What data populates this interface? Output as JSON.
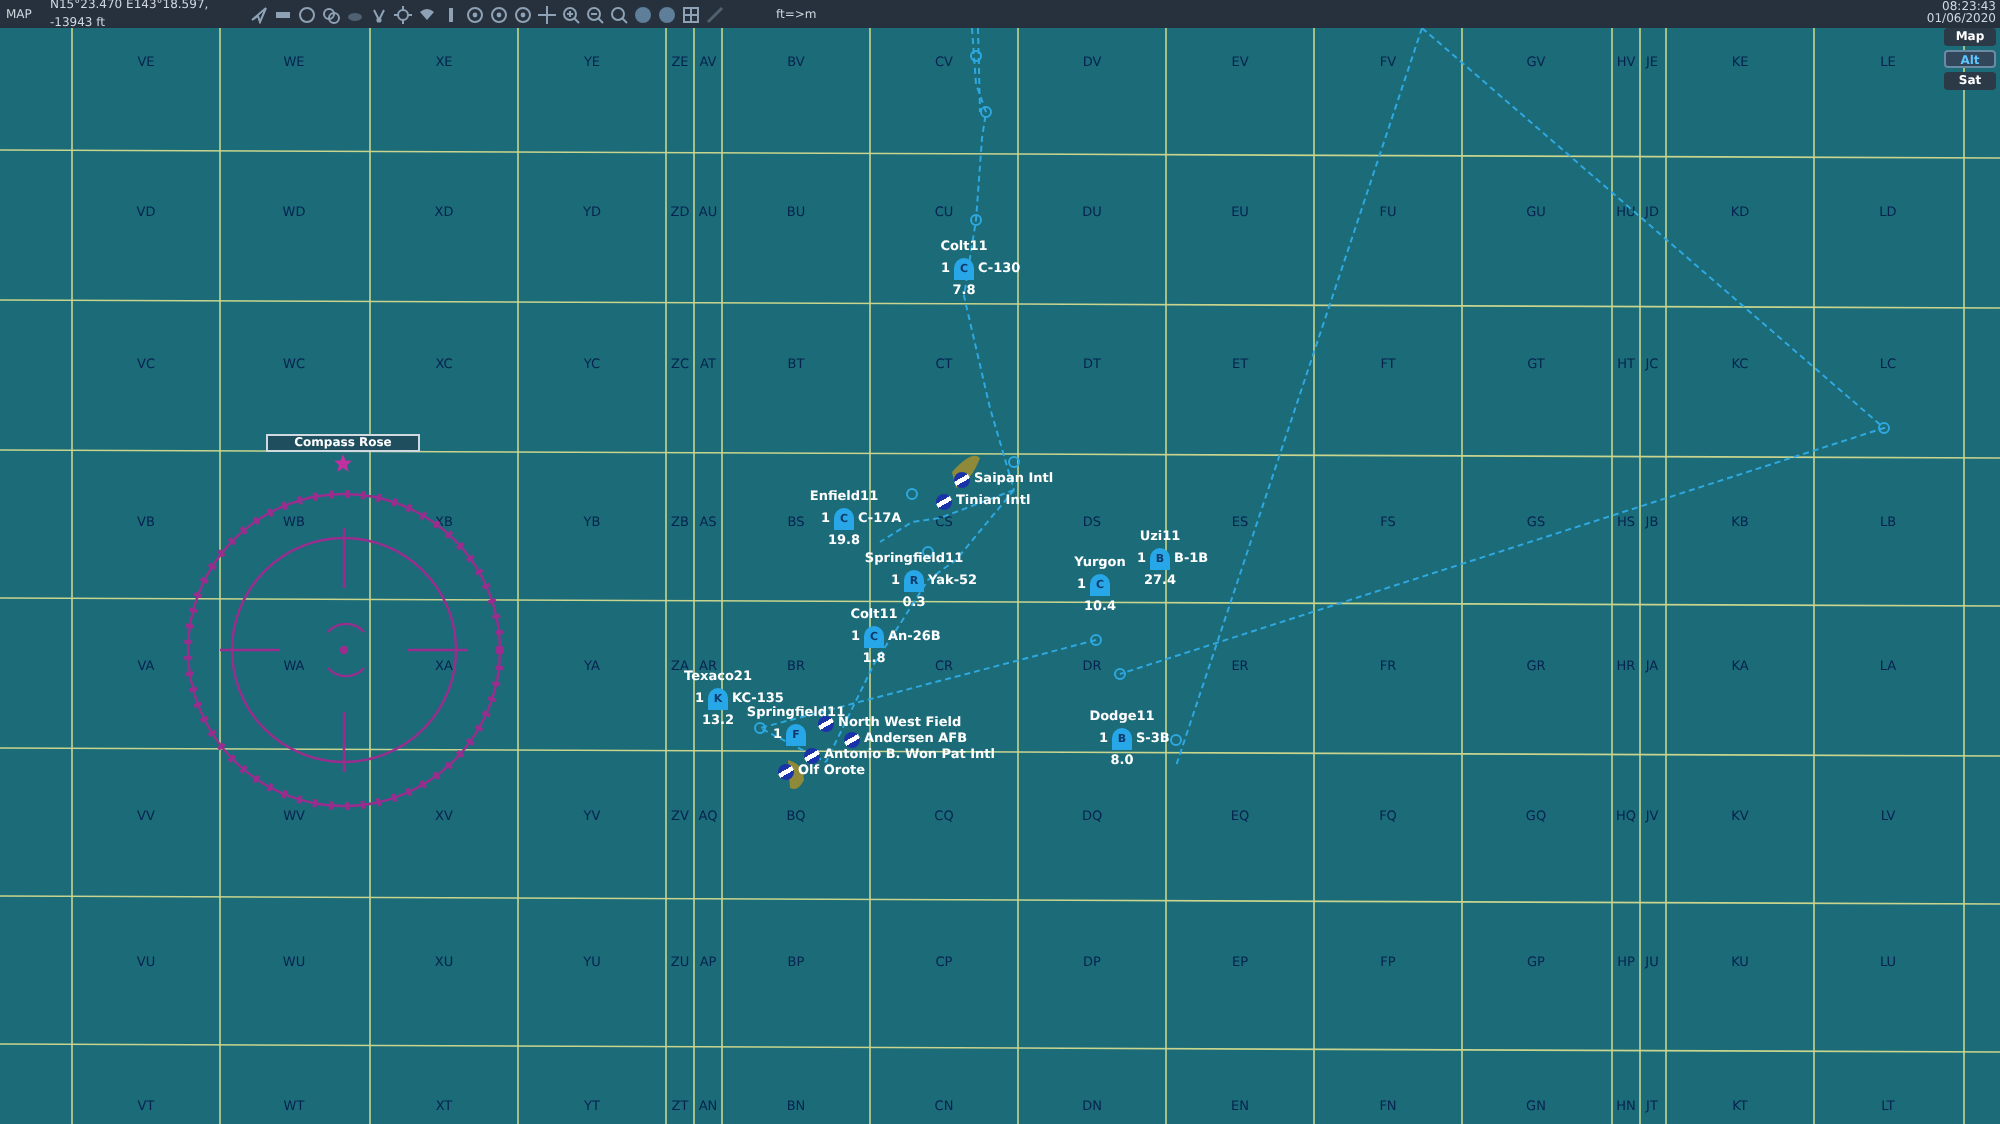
{
  "top_bar": {
    "title": "MAP",
    "coordinates": "N15°23.470 E143°18.597, -13943 ft",
    "unit_toggle": "ft=>m",
    "time": "08:23:43",
    "date": "01/06/2020"
  },
  "map_layers": [
    {
      "label": "Map",
      "selected": false
    },
    {
      "label": "Alt",
      "selected": true
    },
    {
      "label": "Sat",
      "selected": false
    }
  ],
  "grid_rows": [
    [
      "VE",
      "WE",
      "XE",
      "YE",
      "ZE",
      "AV",
      "BV",
      "CV",
      "DV",
      "EV",
      "FV",
      "GV",
      "HV",
      "JE",
      "KE",
      "LE"
    ],
    [
      "VD",
      "WD",
      "XD",
      "YD",
      "ZD",
      "AU",
      "BU",
      "CU",
      "DU",
      "EU",
      "FU",
      "GU",
      "HU",
      "JD",
      "KD",
      "LD"
    ],
    [
      "VC",
      "WC",
      "XC",
      "YC",
      "ZC",
      "AT",
      "BT",
      "CT",
      "DT",
      "ET",
      "FT",
      "GT",
      "HT",
      "JC",
      "KC",
      "LC"
    ],
    [
      "VB",
      "WB",
      "XB",
      "YB",
      "ZB",
      "AS",
      "BS",
      "CS",
      "DS",
      "ES",
      "FS",
      "GS",
      "HS",
      "JB",
      "KB",
      "LB"
    ],
    [
      "VA",
      "WA",
      "XA",
      "YA",
      "ZA",
      "AR",
      "BR",
      "CR",
      "DR",
      "ER",
      "FR",
      "GR",
      "HR",
      "JA",
      "KA",
      "LA"
    ],
    [
      "VV",
      "WV",
      "XV",
      "YV",
      "ZV",
      "AQ",
      "BQ",
      "CQ",
      "DQ",
      "EQ",
      "FQ",
      "GQ",
      "HQ",
      "JV",
      "KV",
      "LV"
    ],
    [
      "VU",
      "WU",
      "XU",
      "YU",
      "ZU",
      "AP",
      "BP",
      "CP",
      "DP",
      "EP",
      "FP",
      "GP",
      "HP",
      "JU",
      "KU",
      "LU"
    ],
    [
      "VT",
      "WT",
      "XT",
      "YT",
      "ZT",
      "AN",
      "BN",
      "CN",
      "DN",
      "EN",
      "FN",
      "GN",
      "HN",
      "JT",
      "KT",
      "LT"
    ]
  ],
  "compass_rose": {
    "label": "Compass Rose"
  },
  "airbases": [
    {
      "name": "Saipan Intl"
    },
    {
      "name": "Tinian Intl"
    },
    {
      "name": "North West Field"
    },
    {
      "name": "Andersen AFB"
    },
    {
      "name": "Antonio B. Won Pat Intl"
    },
    {
      "name": "Olf Orote"
    }
  ],
  "units": [
    {
      "name": "Colt11",
      "count": "1",
      "symbol": "C",
      "type": "C-130",
      "value": "7.8"
    },
    {
      "name": "Enfield11",
      "count": "1",
      "symbol": "C",
      "type": "C-17A",
      "value": "19.8"
    },
    {
      "name": "Springfield11",
      "count": "1",
      "symbol": "R",
      "type": "Yak-52",
      "value": "0.3"
    },
    {
      "name": "Colt11",
      "count": "1",
      "symbol": "C",
      "type": "An-26B",
      "value": "1.8"
    },
    {
      "name": "Texaco21",
      "count": "1",
      "symbol": "K",
      "type": "KC-135",
      "value": "13.2"
    },
    {
      "name": "Springfield11",
      "count": "1",
      "symbol": "F"
    },
    {
      "name": "Yurgon",
      "count": "1",
      "symbol": "C",
      "value": "10.4"
    },
    {
      "name": "Uzi11",
      "count": "1",
      "symbol": "B",
      "type": "B-1B",
      "value": "27.4"
    },
    {
      "name": "Dodge11",
      "count": "1",
      "symbol": "B",
      "type": "S-3B",
      "value": "8.0"
    }
  ]
}
